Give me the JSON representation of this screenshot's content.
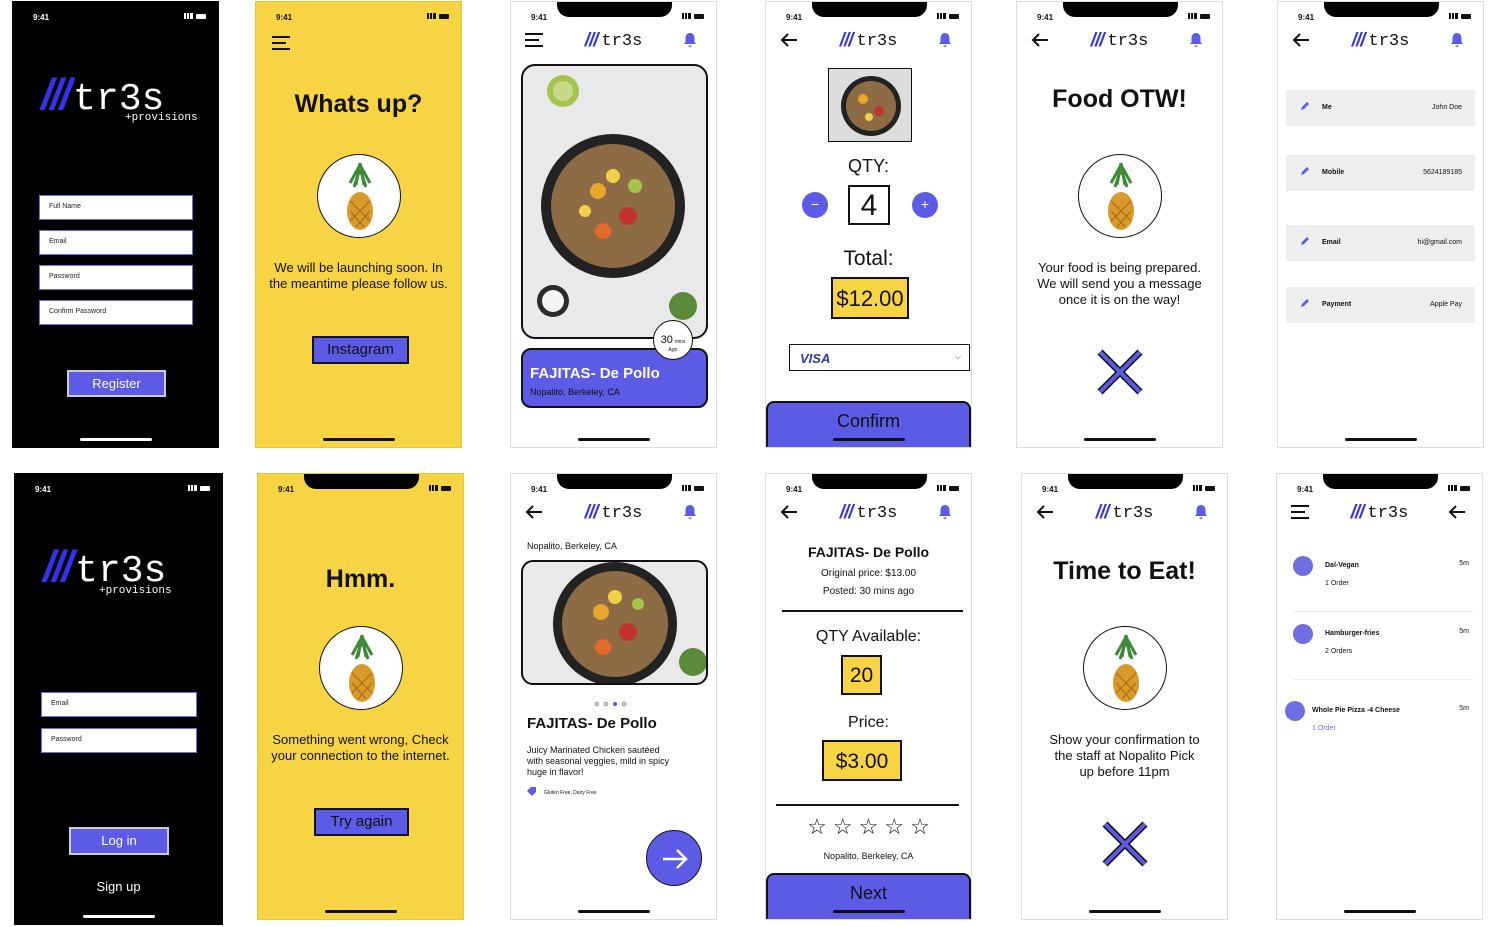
{
  "status": {
    "time": "9:41"
  },
  "brand": {
    "slashes": "///",
    "name": "tr3s",
    "tagline": "+provisions"
  },
  "register": {
    "fields": [
      "Full Name",
      "Email",
      "Password",
      "Confirm Password"
    ],
    "button": "Register"
  },
  "login": {
    "fields": [
      "Email",
      "Password"
    ],
    "button": "Log in",
    "signup": "Sign up"
  },
  "whatsup": {
    "title": "Whats up?",
    "body": "We will be launching soon. In the meantime please follow us.",
    "button": "Instagram"
  },
  "hmm": {
    "title": "Hmm.",
    "body": "Something went wrong, Check your connection to the internet.",
    "button": "Try again"
  },
  "feed": {
    "badge_num": "30",
    "badge_unit": "mins",
    "badge_ago": "Ago",
    "dish": "FAJITAS- De Pollo",
    "location": "Nopalito, Berkeley, CA"
  },
  "detail": {
    "location": "Nopalito, Berkeley, CA",
    "dish": "FAJITAS- De Pollo",
    "description": "Juicy Marinated Chicken sautéed with seasonal veggies, mild in spicy huge in flavor!",
    "tags": "Gluten Free, Dairy Free",
    "dots": 4,
    "active_dot": 3
  },
  "order": {
    "qty_label": "QTY:",
    "qty": "4",
    "minus": "−",
    "plus": "+",
    "total_label": "Total:",
    "total": "$12.00",
    "card": "VISA",
    "confirm": "Confirm"
  },
  "listing": {
    "dish": "FAJITAS- De Pollo",
    "original": "Original price: $13.00",
    "posted": "Posted: 30 mins ago",
    "qty_label": "QTY Available:",
    "qty": "20",
    "price_label": "Price:",
    "price": "$3.00",
    "stars": 5,
    "location": "Nopalito, Berkeley, CA",
    "next": "Next"
  },
  "otw": {
    "title": "Food OTW!",
    "body": "Your food is being prepared. We will send you a message once it is on the way!"
  },
  "eat": {
    "title": "Time to Eat!",
    "body": "Show your confirmation to the staff at Nopalito Pick up before 11pm"
  },
  "profile": [
    {
      "key": "Me",
      "value": "John Doe"
    },
    {
      "key": "Mobile",
      "value": "5624189185"
    },
    {
      "key": "Email",
      "value": "hi@gmail.com"
    },
    {
      "key": "Payment",
      "value": "Apple Pay"
    }
  ],
  "orders": [
    {
      "name": "Dal-Vegan",
      "count": "1 Order",
      "time": "5m"
    },
    {
      "name": "Hamburger-fries",
      "count": "2 Orders",
      "time": "5m"
    },
    {
      "name": "Whole Pie Pizza -4 Cheese",
      "count": "1 Order",
      "time": "5m"
    }
  ],
  "colors": {
    "accent": "#5b5be6",
    "yellow": "#f7d444",
    "brand_blue": "#3333ee"
  },
  "icons": [
    "menu-icon",
    "bell-icon",
    "back-arrow-icon",
    "pencil-icon",
    "close-x-icon",
    "arrow-right-icon",
    "tag-icon",
    "pineapple-image"
  ]
}
